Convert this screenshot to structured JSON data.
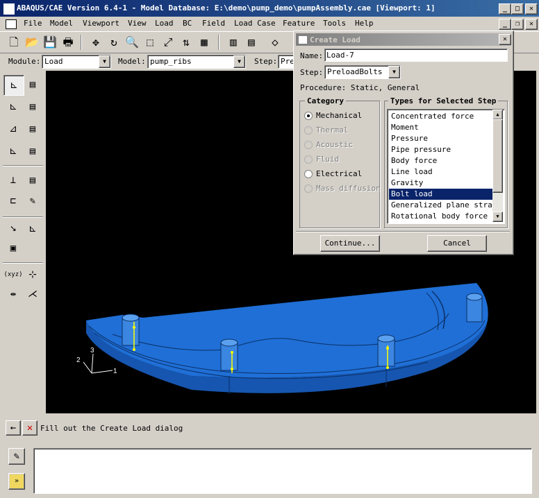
{
  "window": {
    "title": "ABAQUS/CAE Version 6.4-1 - Model Database: E:\\demo\\pump_demo\\pumpAssembly.cae [Viewport: 1]",
    "minimize": "_",
    "restore": "□",
    "close": "✕"
  },
  "menubar": {
    "items": [
      "File",
      "Model",
      "Viewport",
      "View",
      "Load",
      "BC",
      "Field",
      "Load Case",
      "Feature",
      "Tools",
      "Help"
    ],
    "mdi_minimize": "_",
    "mdi_restore": "❐",
    "mdi_close": "✕"
  },
  "context": {
    "module_label": "Module:",
    "module_value": "Load",
    "model_label": "Model:",
    "model_value": "pump_ribs",
    "step_label": "Step:",
    "step_value": "Pre"
  },
  "viewport": {
    "triad": {
      "x": "1",
      "y": "2",
      "z": "3"
    }
  },
  "prompt": {
    "text": "Fill out the Create Load dialog"
  },
  "dialog": {
    "title": "Create Load",
    "close": "✕",
    "name_label": "Name:",
    "name_value": "Load-7",
    "step_label": "Step:",
    "step_value": "PreloadBolts",
    "procedure": "Procedure: Static, General",
    "category_title": "Category",
    "categories": [
      {
        "label": "Mechanical",
        "enabled": true,
        "selected": true
      },
      {
        "label": "Thermal",
        "enabled": false,
        "selected": false
      },
      {
        "label": "Acoustic",
        "enabled": false,
        "selected": false
      },
      {
        "label": "Fluid",
        "enabled": false,
        "selected": false
      },
      {
        "label": "Electrical",
        "enabled": true,
        "selected": false
      },
      {
        "label": "Mass diffusion",
        "enabled": false,
        "selected": false
      }
    ],
    "types_title": "Types for Selected Step",
    "types": [
      "Concentrated force",
      "Moment",
      "Pressure",
      "Pipe pressure",
      "Body force",
      "Line load",
      "Gravity",
      "Bolt load",
      "Generalized plane strain",
      "Rotational body force"
    ],
    "selected_type": "Bolt load",
    "continue_label": "Continue...",
    "cancel_label": "Cancel"
  },
  "colors": {
    "titlebar_active": "#0a246a",
    "selection": "#0a246a",
    "part_blue": "#1f6fd6",
    "bolt_marker": "#ffff00",
    "viewport_bg": "#000000",
    "cancel_x": "#cc0000"
  }
}
